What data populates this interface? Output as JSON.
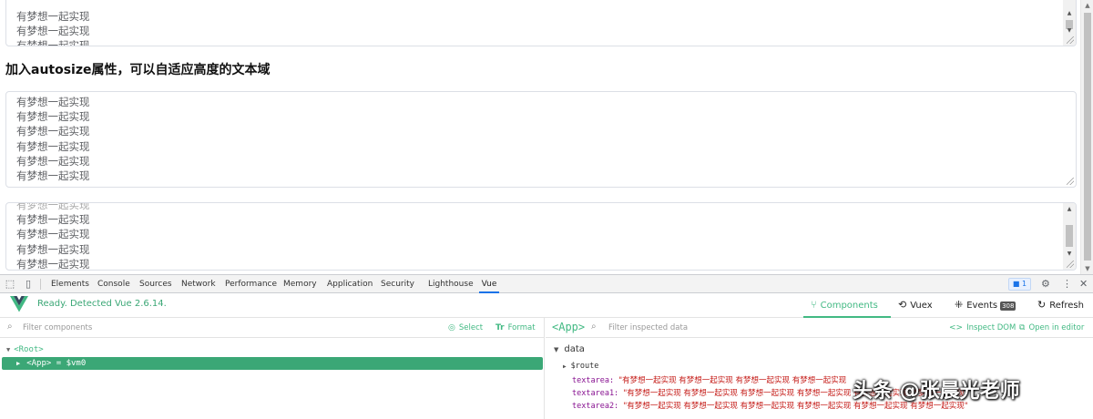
{
  "page": {
    "textarea_top_lines": [
      "有梦想一起实现",
      "有梦想一起实现",
      "有梦想一起实现"
    ],
    "heading": "加入autosize属性，可以自适应高度的文本域",
    "textarea_autosize_lines": [
      "有梦想一起实现",
      "有梦想一起实现",
      "有梦想一起实现",
      "有梦想一起实现",
      "有梦想一起实现",
      "有梦想一起实现"
    ],
    "textarea_bottom_lines": [
      "有梦想一起实现",
      "有梦想一起实现",
      "有梦想一起实现",
      "有梦想一起实现",
      "有梦想一起实现"
    ]
  },
  "devtools": {
    "tabs": [
      "Elements",
      "Console",
      "Sources",
      "Network",
      "Performance",
      "Memory",
      "Application",
      "Security",
      "Lighthouse",
      "Vue"
    ],
    "active_tab": "Vue",
    "issues_count": "1",
    "vue": {
      "status": "Ready. Detected Vue 2.6.14.",
      "nav": {
        "components": "Components",
        "vuex": "Vuex",
        "events": "Events",
        "events_count": "308",
        "refresh": "Refresh"
      },
      "left": {
        "filter_placeholder": "Filter components",
        "select_label": "Select",
        "format_label": "Format",
        "root_label": "<Root>",
        "app_label": "<App> = $vm0"
      },
      "right": {
        "component_tag": "<App>",
        "filter_placeholder": "Filter inspected data",
        "inspect_dom": "Inspect DOM",
        "open_in_editor": "Open in editor",
        "section": "data",
        "route_key": "$route",
        "rows": [
          {
            "key": "textarea:",
            "value": "\"有梦想一起实现 有梦想一起实现 有梦想一起实现 有梦想一起实现"
          },
          {
            "key": "textarea1:",
            "value": "\"有梦想一起实现 有梦想一起实现 有梦想一起实现 有梦想一起实现 有梦想一起实现 有梦想一起实现\""
          },
          {
            "key": "textarea2:",
            "value": "\"有梦想一起实现 有梦想一起实现 有梦想一起实现 有梦想一起实现 有梦想一起实现 有梦想一起实现\""
          }
        ]
      }
    }
  },
  "watermark": "头条 @张晨光老师",
  "colors": {
    "vue_green": "#42b983",
    "selection_green": "#3ba776",
    "string_red": "#c41a16",
    "key_purple": "#881391",
    "devtools_blue": "#1a73e8"
  }
}
